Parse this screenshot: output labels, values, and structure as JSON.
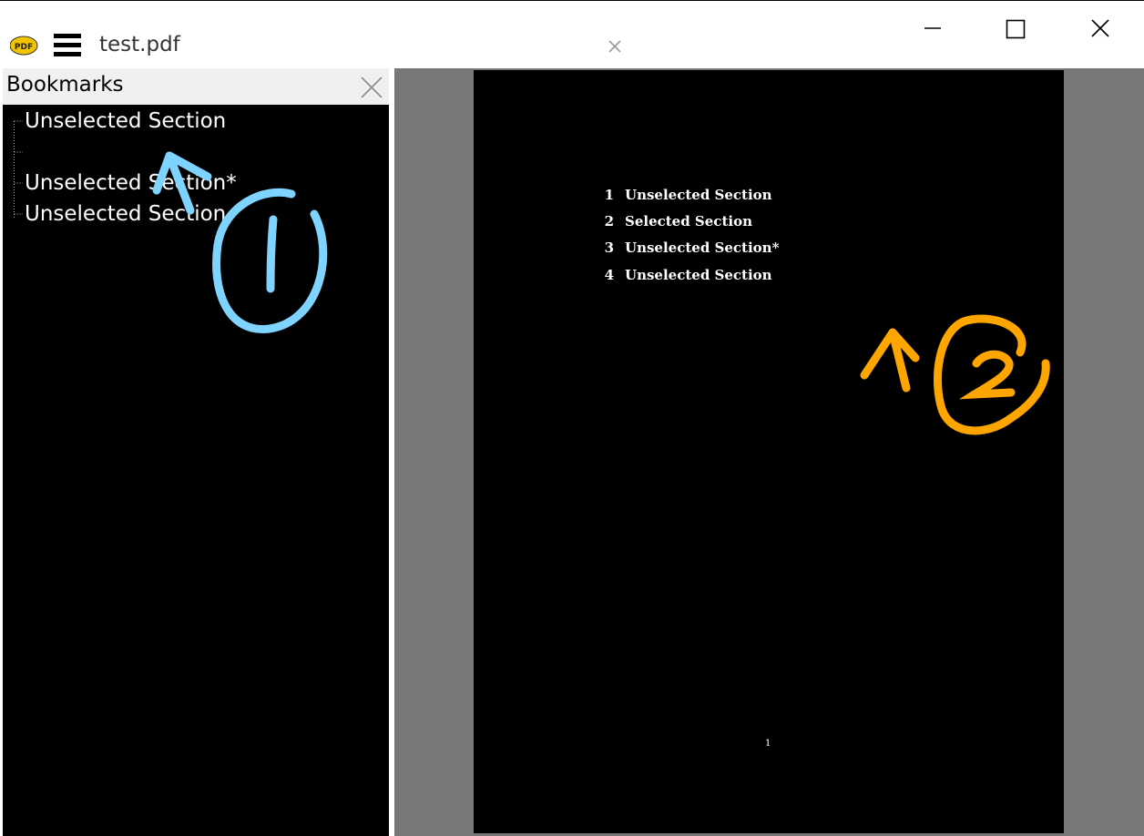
{
  "titlebar": {
    "app_icon": "sumatra-pdf-icon",
    "menu_icon": "hamburger-menu-icon",
    "tab_title": "test.pdf",
    "tab_close_icon": "close-icon",
    "window_controls": [
      "minimize-icon",
      "maximize-icon",
      "close-icon"
    ]
  },
  "sidebar": {
    "title": "Bookmarks",
    "close_icon": "close-icon",
    "items": [
      {
        "label": "Unselected Section"
      },
      {
        "label": ""
      },
      {
        "label": "Unselected Section*"
      },
      {
        "label": "Unselected Section"
      }
    ]
  },
  "document": {
    "toc": [
      {
        "number": "1",
        "title": "Unselected Section"
      },
      {
        "number": "2",
        "title": "Selected Section"
      },
      {
        "number": "3",
        "title": "Unselected Section*"
      },
      {
        "number": "4",
        "title": "Unselected Section"
      }
    ],
    "page_number": "1"
  },
  "annotations": {
    "marker_1": "1",
    "marker_2": "2",
    "color_1": "#7fd3ff",
    "color_2": "#ffa500"
  },
  "colors": {
    "sidebar_bg": "#000000",
    "page_bg": "#000000",
    "viewer_bg": "#787878"
  }
}
